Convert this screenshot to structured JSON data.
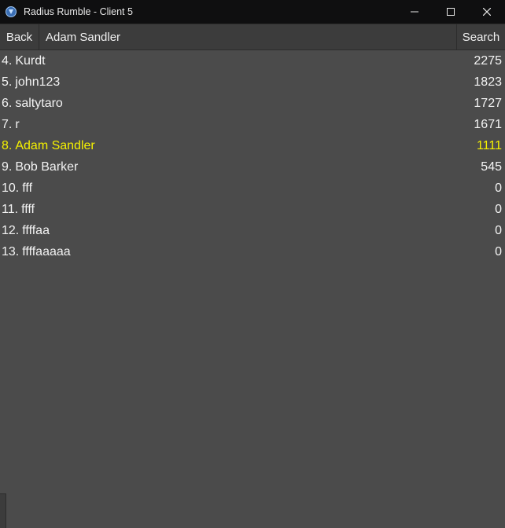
{
  "window": {
    "title": "Radius Rumble - Client 5"
  },
  "toolbar": {
    "back_label": "Back",
    "search_label": "Search",
    "search_value": "Adam Sandler"
  },
  "highlight_name": "Adam Sandler",
  "leaderboard": [
    {
      "rank": 4,
      "name": "Kurdt",
      "score": 2275
    },
    {
      "rank": 5,
      "name": "john123",
      "score": 1823
    },
    {
      "rank": 6,
      "name": "saltytaro",
      "score": 1727
    },
    {
      "rank": 7,
      "name": "r",
      "score": 1671
    },
    {
      "rank": 8,
      "name": "Adam Sandler",
      "score": 1111
    },
    {
      "rank": 9,
      "name": "Bob Barker",
      "score": 545
    },
    {
      "rank": 10,
      "name": "fff",
      "score": 0
    },
    {
      "rank": 11,
      "name": "ffff",
      "score": 0
    },
    {
      "rank": 12,
      "name": "ffffaa",
      "score": 0
    },
    {
      "rank": 13,
      "name": "ffffaaaaa",
      "score": 0
    }
  ]
}
